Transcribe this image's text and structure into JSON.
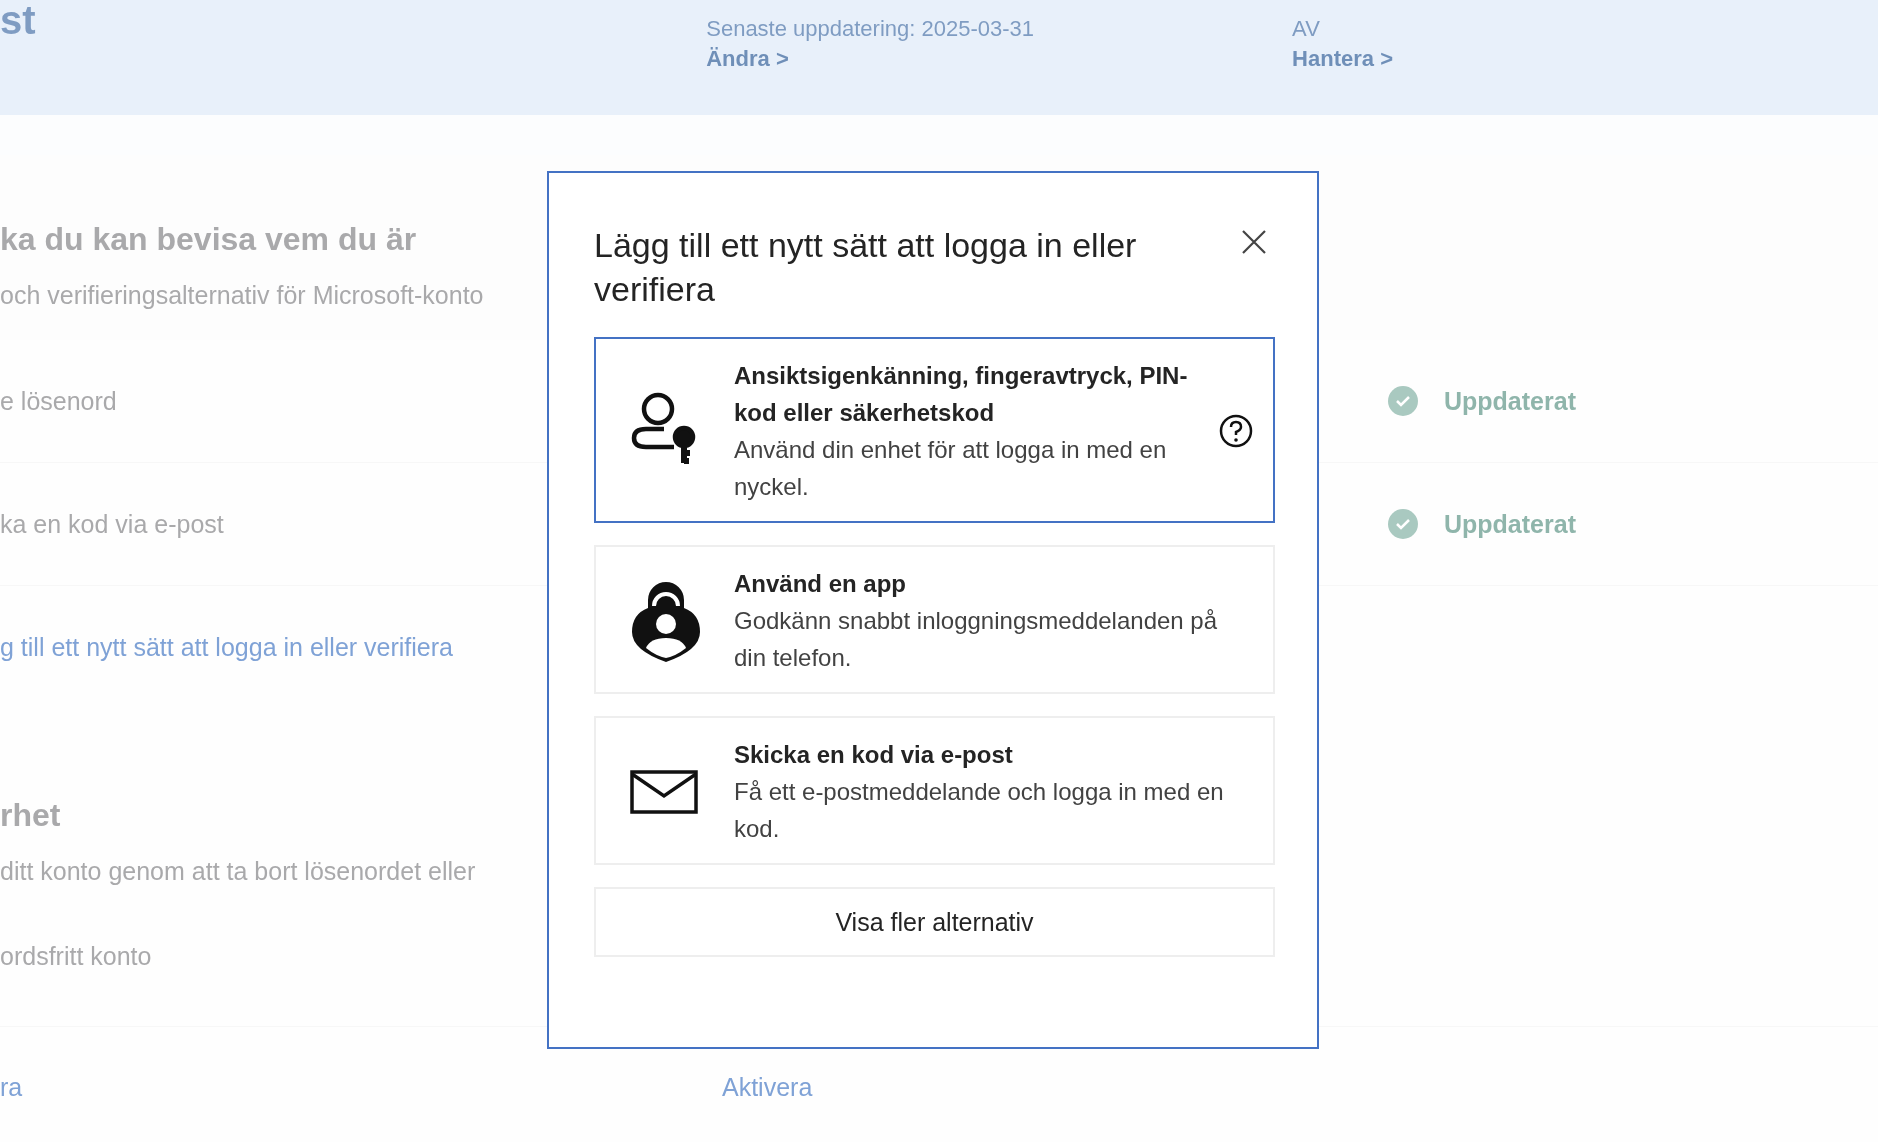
{
  "banner": {
    "heading": "st",
    "items": [
      {
        "text": "Senaste uppdatering: 2025-03-31",
        "link": "Ändra >"
      },
      {
        "text": "AV",
        "link": "Hantera >"
      }
    ]
  },
  "section_1": {
    "heading": "ka du kan bevisa vem du är",
    "description": "och verifieringsalternativ för Microsoft-konto",
    "rows": [
      {
        "label": "e lösenord",
        "status": "Uppdaterat"
      },
      {
        "label": "ka en kod via e-post",
        "status": "Uppdaterat"
      }
    ],
    "link": "g till ett nytt sätt att logga in eller verifiera"
  },
  "section_2": {
    "heading": "rhet",
    "description": "ditt konto genom att ta bort lösenordet eller",
    "row_label": "ordsfritt konto",
    "links": [
      "ra",
      "Aktivera"
    ]
  },
  "dialog": {
    "title": "Lägg till ett nytt sätt att logga in eller verifiera",
    "options": [
      {
        "kind": "passkey",
        "title": "Ansiktsigenkänning, fingeravtryck, PIN-kod eller säkerhetskod",
        "description": "Använd din enhet för att logga in med en nyckel.",
        "selected": true,
        "help": true
      },
      {
        "kind": "app",
        "title": "Använd en app",
        "description": "Godkänn snabbt inloggningsmeddelanden på din telefon.",
        "selected": false,
        "help": false
      },
      {
        "kind": "email",
        "title": "Skicka en kod via e-post",
        "description": "Få ett e-postmeddelande och logga in med en kod.",
        "selected": false,
        "help": false
      }
    ],
    "more_button": "Visa fler alternativ"
  }
}
